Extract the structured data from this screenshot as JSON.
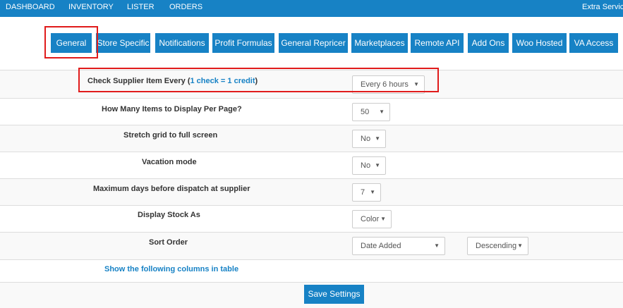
{
  "nav": {
    "items": [
      "DASHBOARD",
      "INVENTORY",
      "LISTER",
      "ORDERS"
    ],
    "right_label": "Extra Servic"
  },
  "tabs": [
    "General",
    "Store Specific",
    "Notifications",
    "Profit Formulas",
    "General Repricer",
    "Marketplaces",
    "Remote API",
    "Add Ons",
    "Woo Hosted",
    "VA Access"
  ],
  "settings": {
    "check_supplier": {
      "label_prefix": "Check Supplier Item Every (",
      "label_accent": "1 check = 1 credit",
      "label_suffix": ")",
      "value": "Every 6 hours"
    },
    "items_per_page": {
      "label": "How Many Items to Display Per Page?",
      "value": "50"
    },
    "stretch_grid": {
      "label": "Stretch grid to full screen",
      "value": "No"
    },
    "vacation_mode": {
      "label": "Vacation mode",
      "value": "No"
    },
    "max_dispatch_days": {
      "label": "Maximum days before dispatch at supplier",
      "value": "7"
    },
    "display_stock": {
      "label": "Display Stock As",
      "value": "Color"
    },
    "sort_order": {
      "label": "Sort Order",
      "field_value": "Date Added",
      "direction_value": "Descending"
    },
    "columns_link": "Show the following columns in table"
  },
  "save_label": "Save Settings",
  "colors": {
    "primary": "#1782c5",
    "highlight": "#e01b1b",
    "row_alt": "#f9f9f9"
  }
}
